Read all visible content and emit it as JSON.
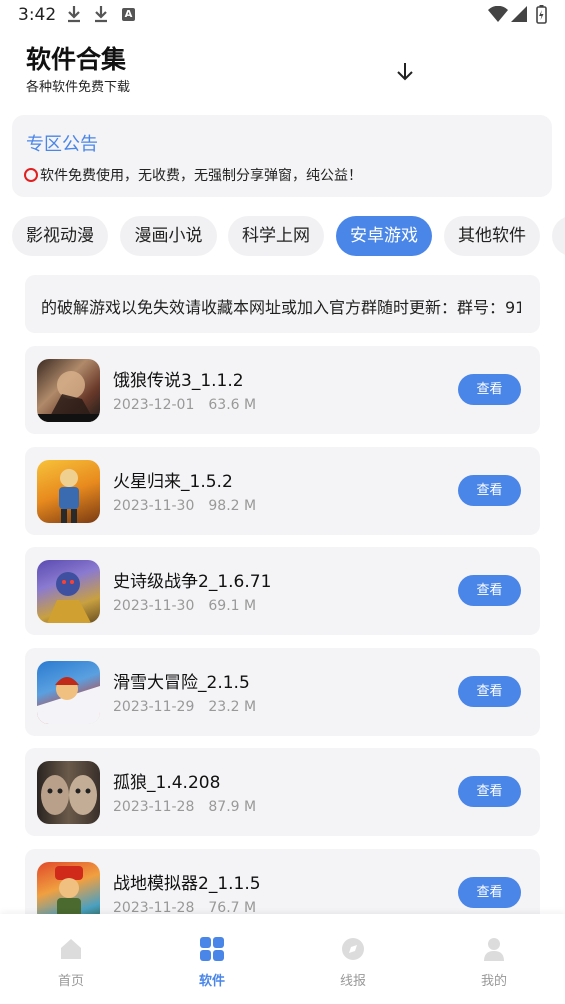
{
  "status_bar": {
    "time": "3:42",
    "ab_badge": "A"
  },
  "header": {
    "title": "软件合集",
    "subtitle": "各种软件免费下载"
  },
  "notice": {
    "title": "专区公告",
    "text": "软件免费使用，无收费，无强制分享弹窗，纯公益！"
  },
  "tabs": [
    {
      "label": "影视动漫"
    },
    {
      "label": "漫画小说"
    },
    {
      "label": "科学上网"
    },
    {
      "label": "安卓游戏",
      "active": true
    },
    {
      "label": "其他软件"
    }
  ],
  "marquee": {
    "text": "的破解游戏以免失效请收藏本网址或加入官方群随时更新：群号：91"
  },
  "apps": [
    {
      "name": "饿狼传说3_1.1.2",
      "date": "2023-12-01",
      "size": "63.6 M",
      "button": "查看"
    },
    {
      "name": "火星归来_1.5.2",
      "date": "2023-11-30",
      "size": "98.2 M",
      "button": "查看"
    },
    {
      "name": "史诗级战争2_1.6.71",
      "date": "2023-11-30",
      "size": "69.1 M",
      "button": "查看"
    },
    {
      "name": "滑雪大冒险_2.1.5",
      "date": "2023-11-29",
      "size": "23.2 M",
      "button": "查看"
    },
    {
      "name": "孤狼_1.4.208",
      "date": "2023-11-28",
      "size": "87.9 M",
      "button": "查看"
    },
    {
      "name": "战地模拟器2_1.1.5",
      "date": "2023-11-28",
      "size": "76.7 M",
      "button": "查看"
    }
  ],
  "bottom_nav": [
    {
      "label": "首页"
    },
    {
      "label": "软件",
      "active": true
    },
    {
      "label": "线报"
    },
    {
      "label": "我的"
    }
  ],
  "colors": {
    "accent": "#4a86e8",
    "card_bg": "#f4f4f6",
    "meta_text": "#999999"
  }
}
